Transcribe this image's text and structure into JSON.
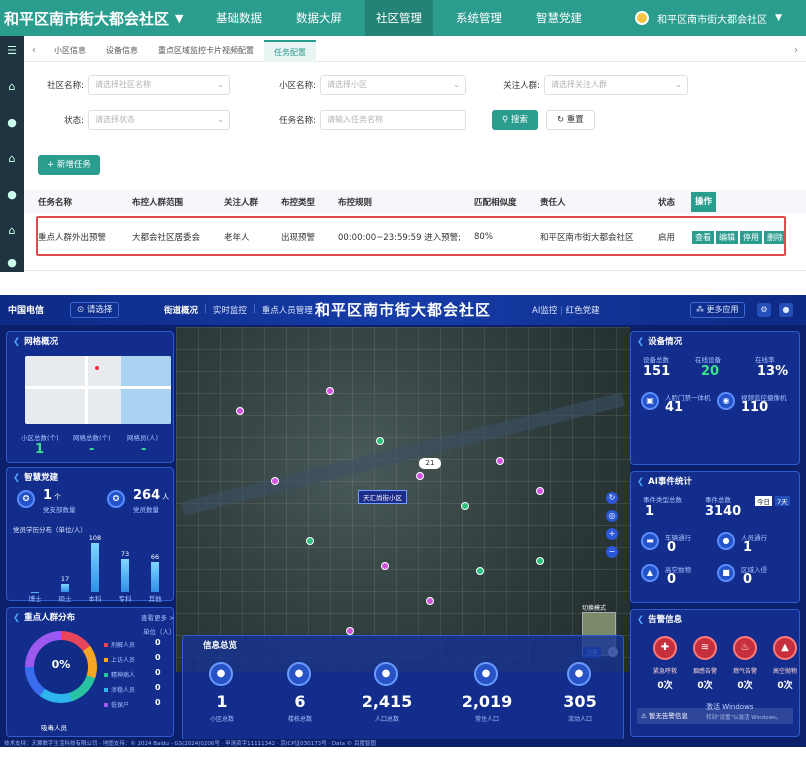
{
  "top": {
    "brand": "和平区南市街大都会社区",
    "nav": [
      "基础数据",
      "数据大屏",
      "社区管理",
      "系统管理",
      "智慧党建"
    ],
    "nav_active": 2,
    "user": "和平区南市街大都会社区",
    "tabs": [
      "小区信息",
      "设备信息",
      "重点区域监控卡片视频配置",
      "任务配置"
    ],
    "tabs_active": 3,
    "form": {
      "community_label": "社区名称:",
      "community_ph": "请选择社区名称",
      "estate_label": "小区名称:",
      "estate_ph": "请选择小区",
      "crowd_label": "关注人群:",
      "crowd_ph": "请选择关注人群",
      "status_label": "状态:",
      "status_ph": "请选择状态",
      "task_label": "任务名称:",
      "task_ph": "请输入任务名称",
      "search": "搜索",
      "reset": "重置"
    },
    "add_button": "+ 新增任务",
    "table": {
      "headers": [
        "任务名称",
        "布控人群范围",
        "关注人群",
        "布控类型",
        "布控规则",
        "匹配相似度",
        "责任人",
        "状态",
        "操作"
      ],
      "row": [
        "重点人群外出预警",
        "大都会社区居委会",
        "老年人",
        "出现预警",
        "00:00:00~23:59:59 进入预警;",
        "80%",
        "和平区南市街大都会社区",
        "启用"
      ],
      "ops": [
        "查看",
        "编辑",
        "停用",
        "删除"
      ]
    }
  },
  "dash": {
    "logo": "中国电信",
    "loc": "请选择",
    "nav_left": [
      "街道概况",
      "实时监控",
      "重点人员管理"
    ],
    "title": "和平区南市街大都会社区",
    "nav_right": [
      "AI监控",
      "红色党建"
    ],
    "more": "更多应用",
    "network": {
      "title": "网格概况",
      "labels": [
        "小区总数(个)",
        "网格总数(个)",
        "网格员(人)"
      ],
      "values": [
        "1",
        "-",
        "-"
      ]
    },
    "party": {
      "title": "智慧党建",
      "branch_num": "1",
      "branch_unit": "个",
      "branch_label": "党支部数量",
      "member_num": "264",
      "member_unit": "人",
      "member_label": "党员数量",
      "chart_title": "党员学历分布（单位/人）"
    },
    "keypeople": {
      "title": "重点人群分布",
      "more": "查看更多 >",
      "unit": "单位（人）",
      "pct": "0%",
      "caption": "吸毒人员",
      "legend": [
        "刑解人员",
        "上访人员",
        "精神病人",
        "涉稳人员",
        "低保户"
      ],
      "legend_values": [
        "0",
        "0",
        "0",
        "0",
        "0"
      ]
    },
    "info": {
      "title": "信息总览",
      "values": [
        "1",
        "6",
        "2,415",
        "2,019",
        "305"
      ],
      "labels": [
        "小区总数",
        "楼栋总数",
        "人口总数",
        "常住人口",
        "流动人口"
      ]
    },
    "device": {
      "title": "设备情况",
      "labels": [
        "设备总数",
        "在线设备",
        "在线率"
      ],
      "values": [
        "151",
        "20",
        "13%"
      ],
      "sub_labels": [
        "人脸门禁一体机",
        "视频监控摄像机"
      ],
      "sub_values": [
        "41",
        "110"
      ]
    },
    "ai": {
      "title": "AI事件统计",
      "toggles": [
        "今日",
        "7天"
      ],
      "type_label": "事件类型总数",
      "type_value": "1",
      "total_label": "事件总数",
      "total_value": "3140",
      "items": [
        "车辆通行",
        "人员通行",
        "高空抛物",
        "区域入侵"
      ],
      "item_values": [
        "0",
        "1",
        "0",
        "0"
      ]
    },
    "alarm": {
      "title": "告警信息",
      "items": [
        "紧急呼救",
        "烟感告警",
        "燃气告警",
        "高空抛物"
      ],
      "values": [
        "0次",
        "0次",
        "0次",
        "0次"
      ],
      "none": "暂无告警信息"
    },
    "map": {
      "selected": "天汇尚街小区",
      "count": "21",
      "minimap_label": "切换模式",
      "btn3d": "卫星"
    },
    "footer": "技术支持：天翼数字生活科技有限公司 · 地图支持：© 2024 Baidu - GS(2024)0206号 · 甲测资字11111342 · 京ICP证030173号 · Data © 百度智图",
    "watermark_1": "激活 Windows",
    "watermark_2": "转到\"设置\"以激活 Windows。"
  },
  "colors": {
    "primary": "#2a9d8f",
    "dash_bg": "#0b1f6b",
    "highlight": "#e14b4b"
  },
  "chart_data": {
    "type": "bar",
    "title": "党员学历分布（单位/人）",
    "categories": [
      "博士",
      "硕士",
      "本科",
      "专科",
      "其他"
    ],
    "values": [
      0,
      17,
      108,
      73,
      66
    ],
    "ylim": [
      0,
      120
    ]
  }
}
